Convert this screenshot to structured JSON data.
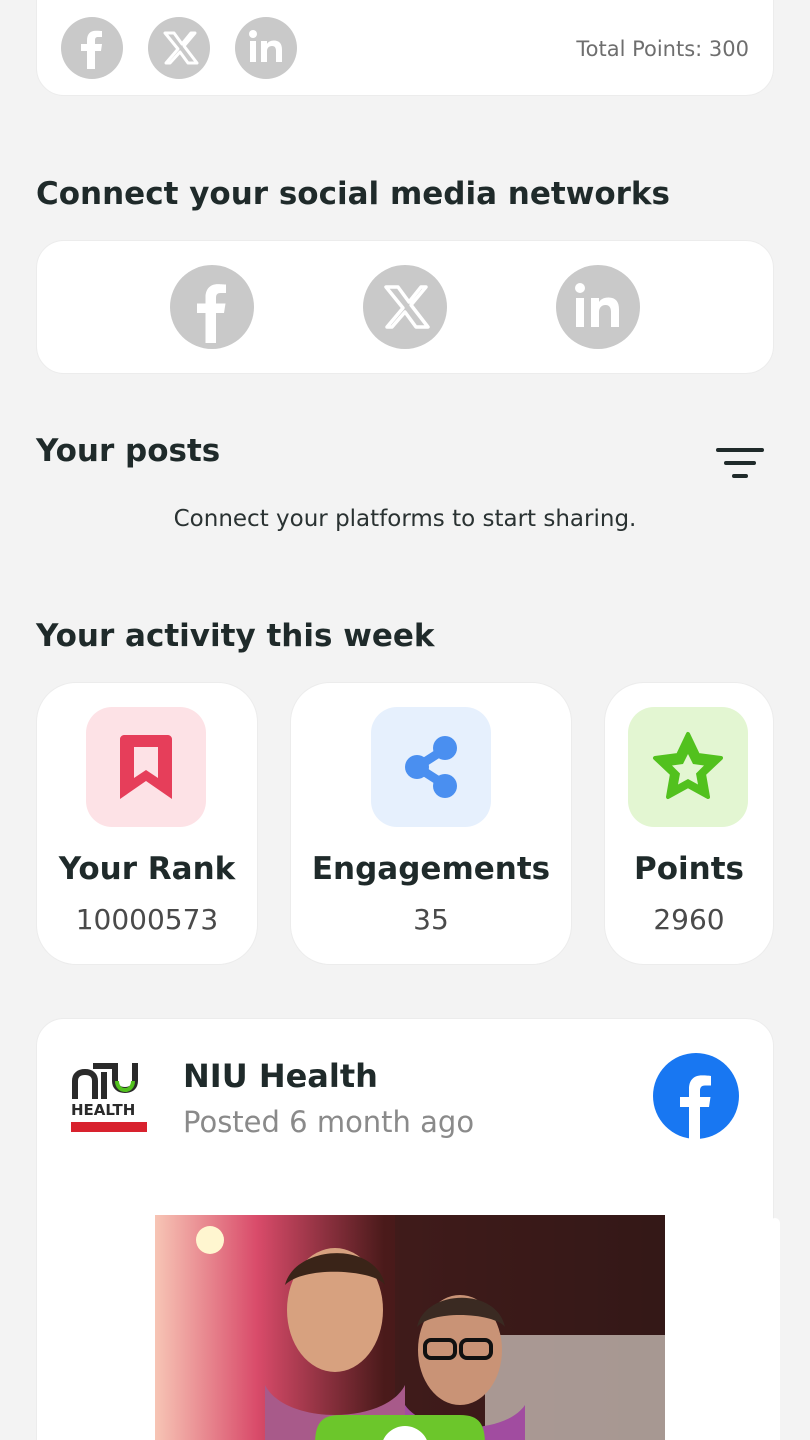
{
  "top_card": {
    "total_points": "Total Points: 300",
    "icons": [
      "facebook-icon",
      "x-icon",
      "linkedin-icon"
    ]
  },
  "connect": {
    "title": "Connect your social media networks",
    "networks": [
      "facebook",
      "x",
      "linkedin"
    ]
  },
  "posts": {
    "title": "Your posts",
    "empty_message": "Connect your platforms to start sharing."
  },
  "activity": {
    "title": "Your activity this week",
    "stats": [
      {
        "label": "Your Rank",
        "value": "10000573",
        "icon": "bookmark-icon",
        "icon_bg": "#fde2e6",
        "icon_color": "#e63e5a"
      },
      {
        "label": "Engagements",
        "value": "35",
        "icon": "share-icon",
        "icon_bg": "#e6f0fd",
        "icon_color": "#4a8ff0"
      },
      {
        "label": "Points",
        "value": "2960",
        "icon": "star-icon",
        "icon_bg": "#e3f6d2",
        "icon_color": "#52c11e"
      }
    ]
  },
  "feed_post": {
    "author": "NIU Health",
    "time": "Posted 6 month ago",
    "platform": "facebook",
    "logo_text": "HEALTH"
  },
  "colors": {
    "background": "#f3f3f3",
    "icon_gray": "#c9c9c9",
    "facebook_blue": "#1877f2",
    "action_green": "#6cc62b"
  }
}
